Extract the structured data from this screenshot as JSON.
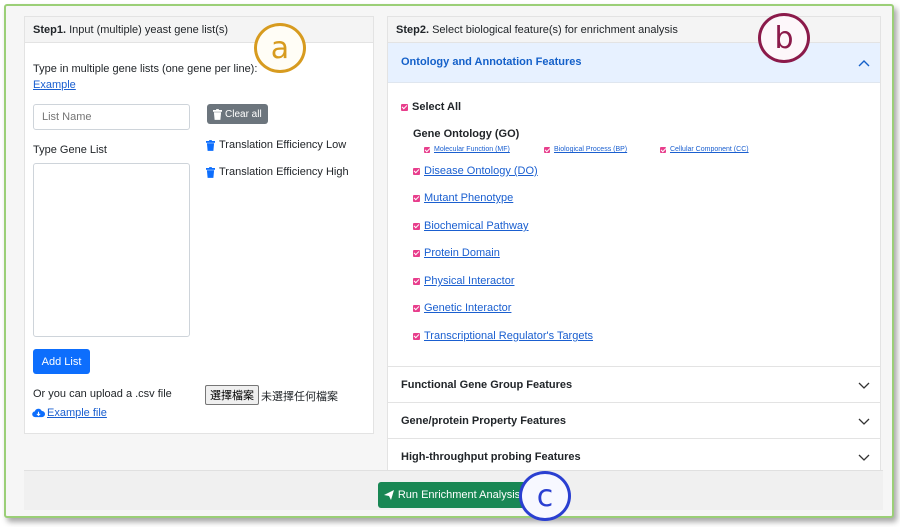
{
  "step1": {
    "title_bold": "Step1.",
    "title_rest": " Input (multiple) yeast gene list(s)",
    "instruction": "Type in multiple gene lists (one gene per line):",
    "example_link": "Example",
    "list_name_placeholder": "List Name",
    "clear_all_label": "Clear all",
    "gene_list_label": "Type Gene List",
    "saved_lists": [
      "Translation Efficiency Low",
      "Translation Efficiency High"
    ],
    "add_list_label": "Add List",
    "upload_text": "Or you can upload a .csv file",
    "choose_file_label": "選擇檔案",
    "no_file_text": "未選擇任何檔案",
    "example_file_link": "Example file"
  },
  "step2": {
    "title_bold": "Step2.",
    "title_rest": " Select biological feature(s) for enrichment analysis",
    "open_section": "Ontology and Annotation Features",
    "select_all": "Select All",
    "go_heading": "Gene Ontology (GO)",
    "go_subs": [
      "Molecular Function (MF)",
      "Biological Process (BP)",
      "Cellular Component (CC)"
    ],
    "features": [
      "Disease Ontology (DO)",
      "Mutant Phenotype",
      "Biochemical Pathway",
      "Protein Domain",
      "Physical Interactor",
      "Genetic Interactor",
      "Transcriptional Regulator's Targets"
    ],
    "collapsed_sections": [
      "Functional Gene Group Features",
      "Gene/protein Property Features",
      "High-throughput probing Features"
    ]
  },
  "run_button_label": "Run Enrichment Analysis",
  "annotations": {
    "a": "a",
    "b": "b",
    "c": "c"
  },
  "colors": {
    "frame_border": "#9bcf77",
    "accent_blue": "#0d6efd",
    "checkbox_pink": "#e83e8c",
    "run_green": "#198754",
    "circle_a": "#d79b1f",
    "circle_b": "#8b1a4a",
    "circle_c": "#2a3fd1"
  }
}
